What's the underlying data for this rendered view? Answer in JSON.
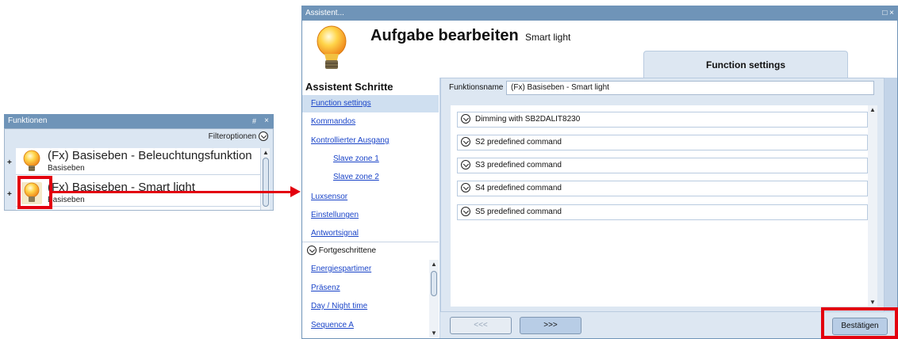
{
  "funktionen_panel": {
    "title": "Funktionen",
    "pin_icon": "#",
    "close_icon": "×",
    "filter_label": "Filteroptionen",
    "items": [
      {
        "title": "(Fx) Basiseben - Beleuchtungsfunktion",
        "subtitle": "Basiseben",
        "icon": "bulb-icon"
      },
      {
        "title": "(Fx) Basiseben - Smart light",
        "subtitle": "Basiseben",
        "icon": "bulb-icon"
      }
    ]
  },
  "wizard": {
    "window_title": "Assistent...",
    "window_controls": "□ ×",
    "heading": "Aufgabe bearbeiten",
    "subheading": "Smart light",
    "active_tab": "Function settings",
    "steps_heading": "Assistent Schritte",
    "steps": [
      {
        "label": "Function settings",
        "active": true,
        "level": 0
      },
      {
        "label": "Kommandos",
        "active": false,
        "level": 0
      },
      {
        "label": "Kontrollierter Ausgang",
        "active": false,
        "level": 0
      },
      {
        "label": "Slave zone 1",
        "active": false,
        "level": 1
      },
      {
        "label": "Slave zone 2",
        "active": false,
        "level": 1
      },
      {
        "label": "Luxsensor",
        "active": false,
        "level": 0
      },
      {
        "label": "Einstellungen",
        "active": false,
        "level": 0
      },
      {
        "label": "Antwortsignal",
        "active": false,
        "level": 0
      }
    ],
    "advanced_label": "Fortgeschrittene",
    "advanced_steps": [
      {
        "label": "Energiespartimer"
      },
      {
        "label": "Präsenz"
      },
      {
        "label": "Day / Night time"
      },
      {
        "label": "Sequence A"
      }
    ],
    "function_name_label": "Funktionsname",
    "function_name_value": "(Fx) Basiseben - Smart light",
    "commands": [
      "Dimming with SB2DALIT8230",
      "S2 predefined command",
      "S3 predefined command",
      "S4 predefined command",
      "S5 predefined command"
    ],
    "buttons": {
      "prev": "<<<",
      "next": ">>>",
      "confirm": "Bestätigen"
    }
  },
  "colors": {
    "highlight": "#e3000f",
    "title_bar": "#6f94b8",
    "link": "#1a44c8"
  }
}
